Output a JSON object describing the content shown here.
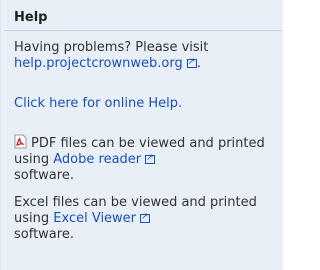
{
  "help": {
    "title": "Help",
    "problem_text": "Having problems? Please visit",
    "help_url_text": "help.projectcrownweb.org",
    "help_url_suffix": ".",
    "online_help_link": "Click here for online Help.",
    "pdf_text_1": "PDF files can be viewed and printed using",
    "pdf_link": "Adobe reader",
    "pdf_text_2": "software.",
    "excel_text_1": "Excel files can be viewed and printed using",
    "excel_link": "Excel Viewer",
    "excel_text_2": "software."
  },
  "colors": {
    "panel_bg": "#e9eff6",
    "link": "#1a4eb8",
    "pdf_icon": "#cc1f1f"
  },
  "icons": [
    "external-link-icon",
    "pdf-icon"
  ]
}
